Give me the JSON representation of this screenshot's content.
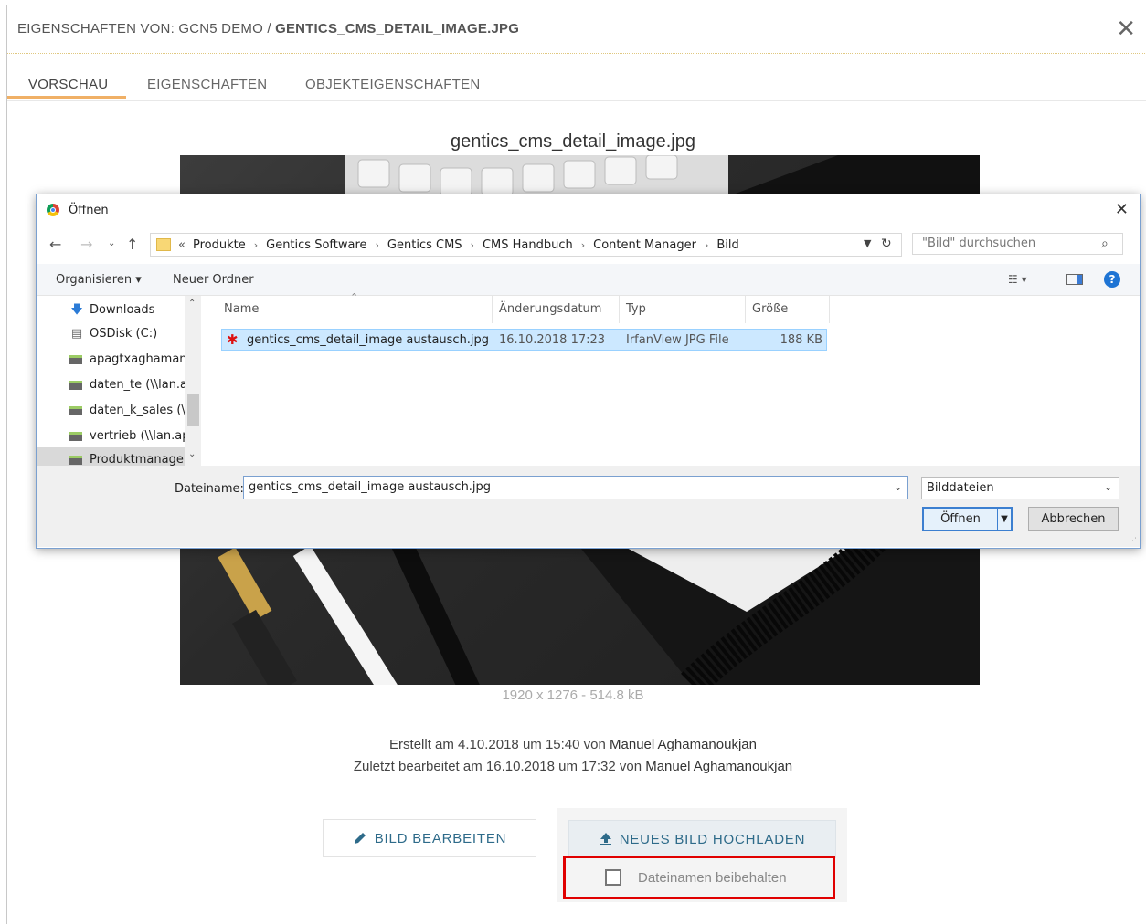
{
  "cms": {
    "title_prefix": "EIGENSCHAFTEN VON: GCN5 DEMO / ",
    "title_file": "GENTICS_CMS_DETAIL_IMAGE.JPG",
    "close": "✕",
    "tabs": [
      "VORSCHAU",
      "EIGENSCHAFTEN",
      "OBJEKTEIGENSCHAFTEN"
    ],
    "image_title": "gentics_cms_detail_image.jpg",
    "image_dims": "1920 x 1276 - 514.8 kB",
    "created_prefix": "Erstellt am 4.10.2018 um 15:40 von ",
    "created_user": "Manuel Aghamanoukjan",
    "edited_prefix": "Zuletzt bearbeitet am 16.10.2018 um 17:32 von ",
    "edited_user": "Manuel Aghamanoukjan",
    "edit_button": "BILD BEARBEITEN",
    "upload_button": "NEUES BILD HOCHLADEN",
    "keep_filename": "Dateinamen beibehalten",
    "keep_filename_checked": false,
    "accent_color": "#f0b066",
    "button_text_color": "#2e6b8a",
    "highlight_color": "#e00000"
  },
  "dialog": {
    "title": "Öffnen",
    "close": "✕",
    "breadcrumb_lead": "«",
    "breadcrumb": [
      "Produkte",
      "Gentics Software",
      "Gentics CMS",
      "CMS Handbuch",
      "Content Manager",
      "Bild"
    ],
    "search_placeholder": "\"Bild\" durchsuchen",
    "toolbar": {
      "organize": "Organisieren ▾",
      "new_folder": "Neuer Ordner"
    },
    "nav_items": [
      {
        "label": "Downloads",
        "icon": "download-arrow-icon"
      },
      {
        "label": "OSDisk (C:)",
        "icon": "disk-icon"
      },
      {
        "label": "apagtxaghaman",
        "icon": "network-drive-icon"
      },
      {
        "label": "daten_te (\\\\lan.a",
        "icon": "network-drive-icon"
      },
      {
        "label": "daten_k_sales (\\\\",
        "icon": "network-drive-icon"
      },
      {
        "label": "vertrieb (\\\\lan.ap",
        "icon": "network-drive-icon"
      },
      {
        "label": "Produktmanage",
        "icon": "network-drive-icon"
      }
    ],
    "columns": {
      "name": "Name",
      "date": "Änderungsdatum",
      "type": "Typ",
      "size": "Größe"
    },
    "files": [
      {
        "name": "gentics_cms_detail_image austausch.jpg",
        "date": "16.10.2018 17:23",
        "type": "IrfanView JPG File",
        "size": "188 KB"
      }
    ],
    "filename_label": "Dateiname:",
    "filename_value": "gentics_cms_detail_image austausch.jpg",
    "filetype": "Bilddateien",
    "open_button": "Öffnen",
    "cancel_button": "Abbrechen"
  }
}
